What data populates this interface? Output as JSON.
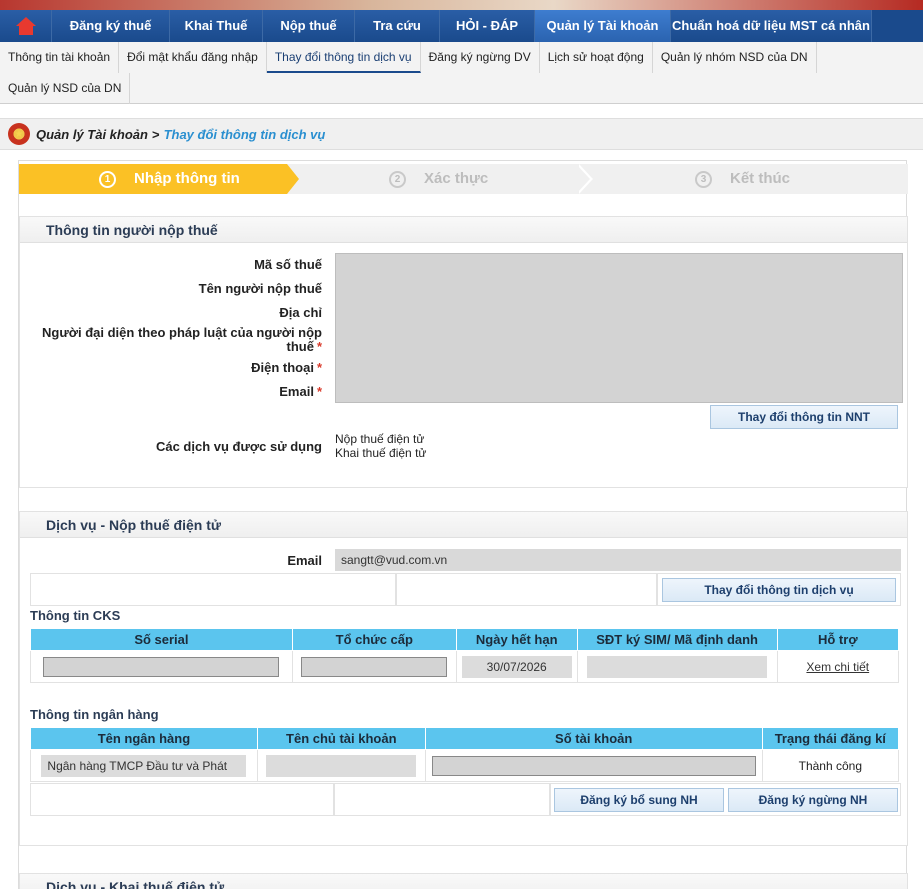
{
  "topnav": {
    "items": [
      "Đăng ký thuế",
      "Khai Thuế",
      "Nộp thuế",
      "Tra cứu",
      "HỎI - ĐÁP",
      "Quản lý Tài khoản",
      "Chuẩn hoá dữ liệu MST cá nhân"
    ],
    "active_index": 5
  },
  "subnav": {
    "row1": [
      "Thông tin tài khoản",
      "Đổi mật khẩu đăng nhập",
      "Thay đổi thông tin dịch vụ",
      "Đăng ký ngừng DV",
      "Lịch sử hoạt động",
      "Quản lý nhóm NSD của DN"
    ],
    "row2": [
      "Quản lý NSD của DN"
    ],
    "active": "Thay đổi thông tin dịch vụ"
  },
  "breadcrumb": {
    "root": "Quản lý Tài khoản",
    "separator": ">",
    "current": "Thay đổi thông tin dịch vụ"
  },
  "steps": [
    {
      "num": "1",
      "label": "Nhập thông tin",
      "active": true
    },
    {
      "num": "2",
      "label": "Xác thực",
      "active": false
    },
    {
      "num": "3",
      "label": "Kết thúc",
      "active": false
    }
  ],
  "taxpayer": {
    "title": "Thông tin người nộp thuế",
    "fields": [
      {
        "label": "Mã số thuế",
        "required": false
      },
      {
        "label": "Tên người nộp thuế",
        "required": false
      },
      {
        "label": "Địa chỉ",
        "required": false
      },
      {
        "label": "Người đại diện theo pháp luật của người nộp thuế",
        "required": true
      },
      {
        "label": "Điện thoại",
        "required": true
      },
      {
        "label": "Email",
        "required": true
      }
    ],
    "required_mark": "*",
    "change_button": "Thay đổi thông tin NNT",
    "services_label": "Các dịch vụ được sử dụng",
    "services": [
      "Nộp thuế điện tử",
      "Khai thuế điện tử"
    ]
  },
  "payment_service": {
    "title": "Dịch vụ - Nộp thuế điện tử",
    "email_label": "Email",
    "email_value": "sangtt@vud.com.vn",
    "change_button": "Thay đổi thông tin dịch vụ",
    "cks": {
      "title": "Thông tin CKS",
      "columns": [
        "Số serial",
        "Tổ chức cấp",
        "Ngày hết hạn",
        "SĐT ký SIM/ Mã định danh",
        "Hỗ trợ"
      ],
      "row": {
        "expiry": "30/07/2026",
        "support_link": "Xem chi tiết"
      }
    },
    "bank": {
      "title": "Thông tin ngân hàng",
      "columns": [
        "Tên ngân hàng",
        "Tên chủ tài khoản",
        "Số tài khoản",
        "Trạng thái đăng kí"
      ],
      "row": {
        "bank_name": "Ngân hàng TMCP Đầu tư và Phát",
        "status": "Thành công"
      },
      "add_button": "Đăng ký bổ sung NH",
      "stop_button": "Đăng ký ngừng NH"
    }
  },
  "declaration_service": {
    "title": "Dịch vụ - Khai thuế điện tử"
  },
  "colors": {
    "nav_bg": "#1a4a8c",
    "step_active": "#fbc125",
    "table_header": "#5bc5ee",
    "required": "#d93a2b",
    "breadcrumb_current": "#2a8fd0"
  }
}
